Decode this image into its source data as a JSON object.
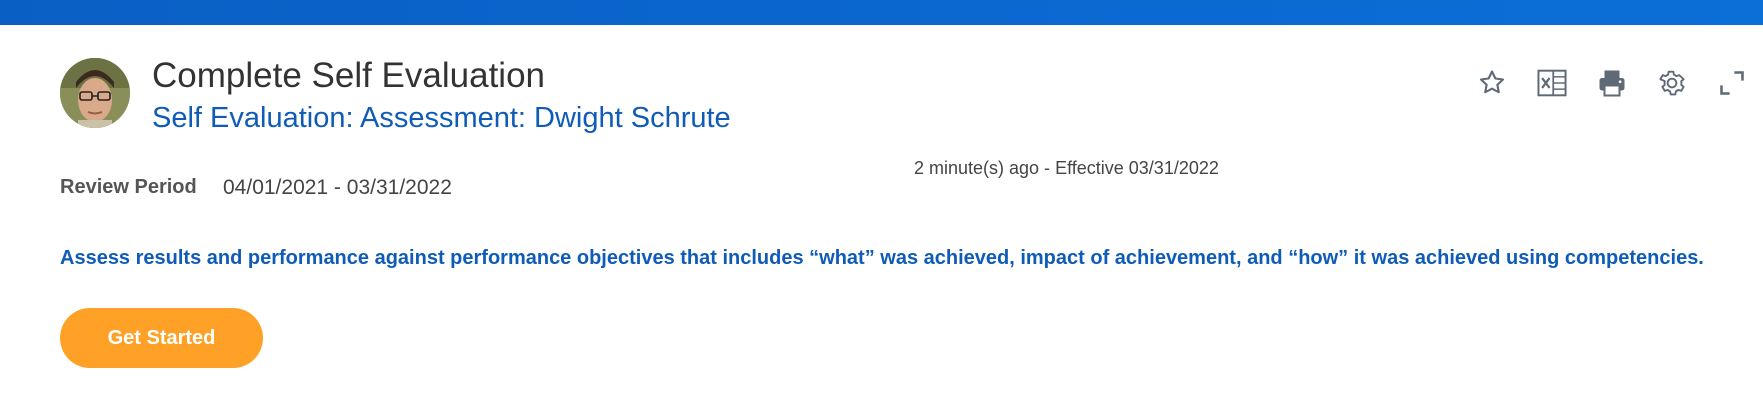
{
  "header": {
    "title": "Complete Self Evaluation",
    "subtitle": "Self Evaluation: Assessment: Dwight Schrute"
  },
  "toolbar": {
    "icons": [
      "star-icon",
      "excel-export-icon",
      "print-icon",
      "gear-icon",
      "expand-icon"
    ]
  },
  "meta": {
    "updated": "2 minute(s) ago -",
    "effective": "Effective 03/31/2022"
  },
  "review": {
    "label": "Review Period",
    "value": "04/01/2021 - 03/31/2022"
  },
  "instructions": "Assess results and performance against performance objectives that includes “what” was achieved, impact of achievement, and “how” it was achieved using competencies.",
  "actions": {
    "get_started": "Get Started"
  },
  "colors": {
    "top_bar": "#0b6fd8",
    "link_blue": "#0f5cb8",
    "button_orange": "#ffa126"
  }
}
